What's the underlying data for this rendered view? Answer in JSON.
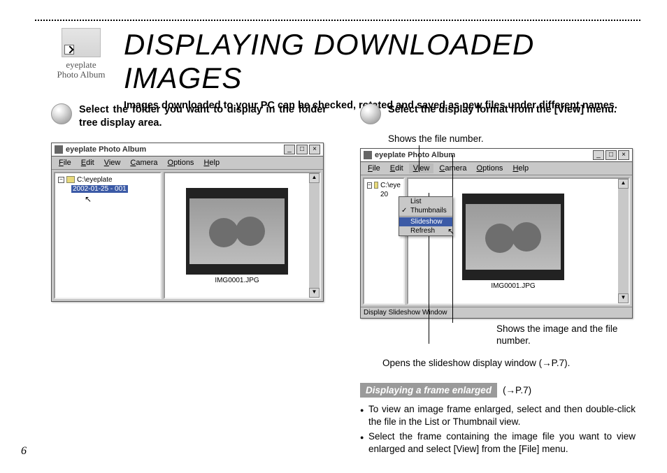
{
  "page_number": "6",
  "app_icon_label": "eyeplate\nPhoto Album",
  "title": "DISPLAYING DOWNLOADED IMAGES",
  "intro": "Images downloaded to your PC can be checked, rotated and saved as new files under different names.",
  "left": {
    "step": "Select the folder you want to display in the folder tree display area.",
    "window": {
      "title": "eyeplate Photo Album",
      "menus": [
        "File",
        "Edit",
        "View",
        "Camera",
        "Options",
        "Help"
      ],
      "tree_root": "C:\\eyeplate",
      "tree_child": "2002-01-25 - 001",
      "thumb_filename": "IMG0001.JPG"
    }
  },
  "right": {
    "step": "Select the display format from the [View] menu.",
    "caption_filenum": "Shows the file number.",
    "caption_thumb": "Shows the image and the file number.",
    "caption_slideshow": "Opens the slideshow display window (→P.7).",
    "window": {
      "title": "eyeplate Photo Album",
      "menus": [
        "File",
        "Edit",
        "View",
        "Camera",
        "Options",
        "Help"
      ],
      "tree_root_short": "C:\\eye",
      "tree_child_short": "20",
      "view_menu": {
        "list": "List",
        "thumbnails": "Thumbnails",
        "slideshow": "Slideshow",
        "refresh": "Refresh"
      },
      "thumb_filename": "IMG0001.JPG",
      "statusbar": "Display Slideshow Window"
    },
    "subhead": "Displaying a frame enlarged",
    "subhead_ref": "(→P.7)",
    "bullets": [
      "To view an image frame enlarged, select and then double-click the file in the List or Thumbnail view.",
      "Select the frame containing the image file you want to view enlarged and select [View] from the [File] menu."
    ]
  }
}
